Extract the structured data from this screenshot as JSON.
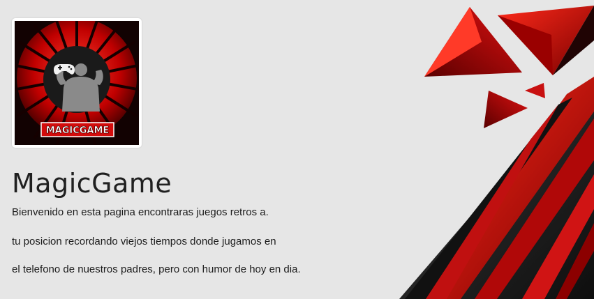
{
  "logo": {
    "text": "MAGICGAME",
    "icon": "controller-icon"
  },
  "header": {
    "title": "MagicGame"
  },
  "intro": {
    "lines": [
      "Bienvenido en esta pagina encontraras juegos retros a.",
      "tu posicion recordando viejos tiempos donde jugamos en",
      "el telefono de nuestros padres, pero con humor de hoy en dia."
    ]
  },
  "theme": {
    "accent": "#d40c0c",
    "dark": "#1a1a1a",
    "background": "#e6e6e6"
  }
}
